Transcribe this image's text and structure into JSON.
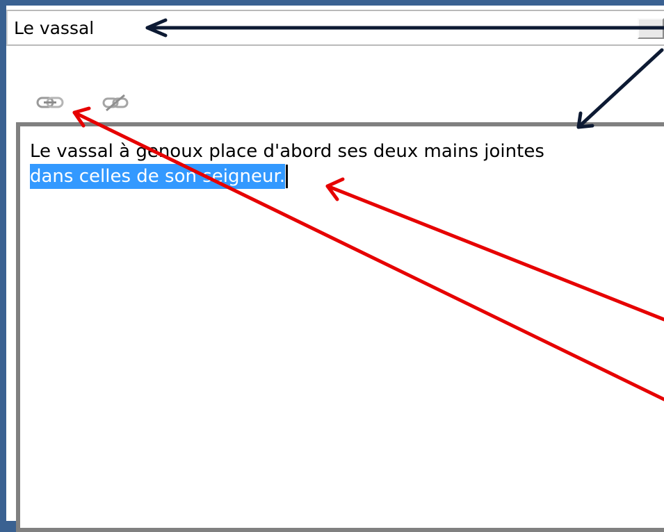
{
  "dropdown": {
    "value": "Le vassal",
    "button_icon": "minus-icon"
  },
  "toolbar": {
    "link_icon": "link-icon",
    "unlink_icon": "unlink-icon"
  },
  "editor": {
    "line1": "Le vassal à genoux place d'abord ses deux mains jointes",
    "line2_selected": "dans celles de son seigneur.",
    "selection_color": "#3399ff"
  },
  "annotations": {
    "navy_arrow_color": "#0d1a33",
    "red_arrow_color": "#e60000"
  }
}
